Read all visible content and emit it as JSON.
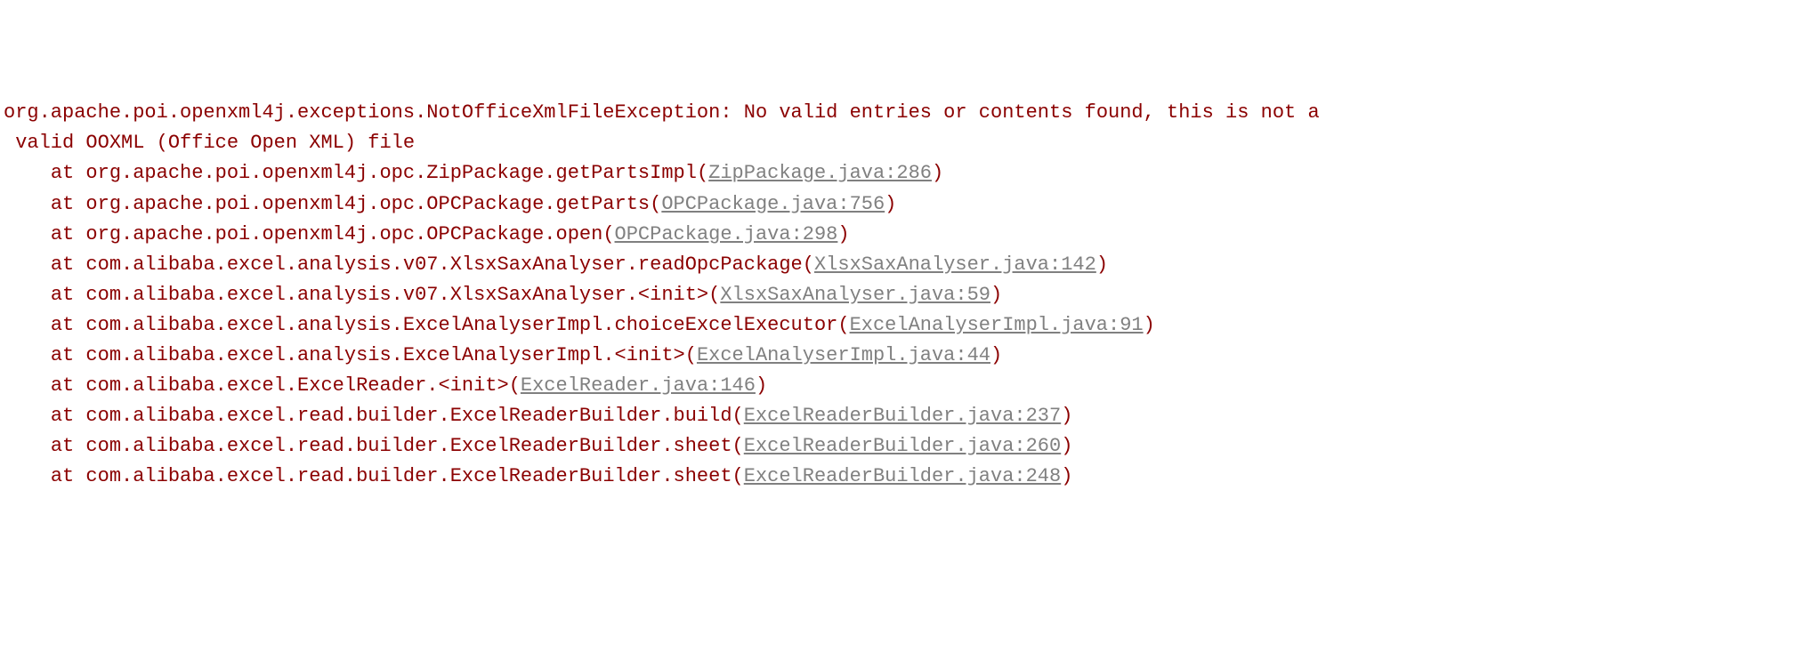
{
  "exception": {
    "type": "org.apache.poi.openxml4j.exceptions.NotOfficeXmlFileException",
    "message": "No valid entries or contents found, this is not a",
    "message_continuation": "valid OOXML (Office Open XML) file",
    "stack": [
      {
        "at": "at",
        "method": "org.apache.poi.openxml4j.opc.ZipPackage.getPartsImpl",
        "file": "ZipPackage.java:286"
      },
      {
        "at": "at",
        "method": "org.apache.poi.openxml4j.opc.OPCPackage.getParts",
        "file": "OPCPackage.java:756"
      },
      {
        "at": "at",
        "method": "org.apache.poi.openxml4j.opc.OPCPackage.open",
        "file": "OPCPackage.java:298"
      },
      {
        "at": "at",
        "method": "com.alibaba.excel.analysis.v07.XlsxSaxAnalyser.readOpcPackage",
        "file": "XlsxSaxAnalyser.java:142"
      },
      {
        "at": "at",
        "method": "com.alibaba.excel.analysis.v07.XlsxSaxAnalyser.<init>",
        "file": "XlsxSaxAnalyser.java:59"
      },
      {
        "at": "at",
        "method": "com.alibaba.excel.analysis.ExcelAnalyserImpl.choiceExcelExecutor",
        "file": "ExcelAnalyserImpl.java:91"
      },
      {
        "at": "at",
        "method": "com.alibaba.excel.analysis.ExcelAnalyserImpl.<init>",
        "file": "ExcelAnalyserImpl.java:44"
      },
      {
        "at": "at",
        "method": "com.alibaba.excel.ExcelReader.<init>",
        "file": "ExcelReader.java:146"
      },
      {
        "at": "at",
        "method": "com.alibaba.excel.read.builder.ExcelReaderBuilder.build",
        "file": "ExcelReaderBuilder.java:237"
      },
      {
        "at": "at",
        "method": "com.alibaba.excel.read.builder.ExcelReaderBuilder.sheet",
        "file": "ExcelReaderBuilder.java:260"
      },
      {
        "at": "at",
        "method": "com.alibaba.excel.read.builder.ExcelReaderBuilder.sheet",
        "file": "ExcelReaderBuilder.java:248"
      }
    ]
  }
}
